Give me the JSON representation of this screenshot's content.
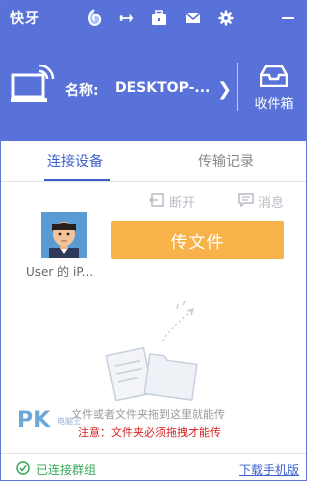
{
  "app": {
    "name": "快牙"
  },
  "titlebar": {
    "icons": [
      "speed-icon",
      "pin-icon",
      "toolbox-icon",
      "mail-icon",
      "gear-icon",
      "minimize-icon"
    ]
  },
  "header": {
    "name_label": "名称:",
    "name_value": "DESKTOP-...",
    "inbox_label": "收件箱"
  },
  "tabs": [
    {
      "label": "连接设备",
      "active": true
    },
    {
      "label": "传输记录",
      "active": false
    }
  ],
  "actions": {
    "disconnect": "断开",
    "message": "消息"
  },
  "device": {
    "name": "User 的 iP..."
  },
  "send_button": "传文件",
  "drop_area": {
    "hint": "文件或者文件夹拖到这里就能传",
    "note": "注意：文件夹必须拖拽才能传"
  },
  "watermark": {
    "text": "PK",
    "sub": "电脑王"
  },
  "footer": {
    "status": "已连接群组",
    "download": "下载手机版"
  },
  "colors": {
    "brand": "#5872d9",
    "accent": "#f8b24a",
    "link": "#3c5fcf",
    "ok": "#3aa85a",
    "warn": "#d22020"
  }
}
